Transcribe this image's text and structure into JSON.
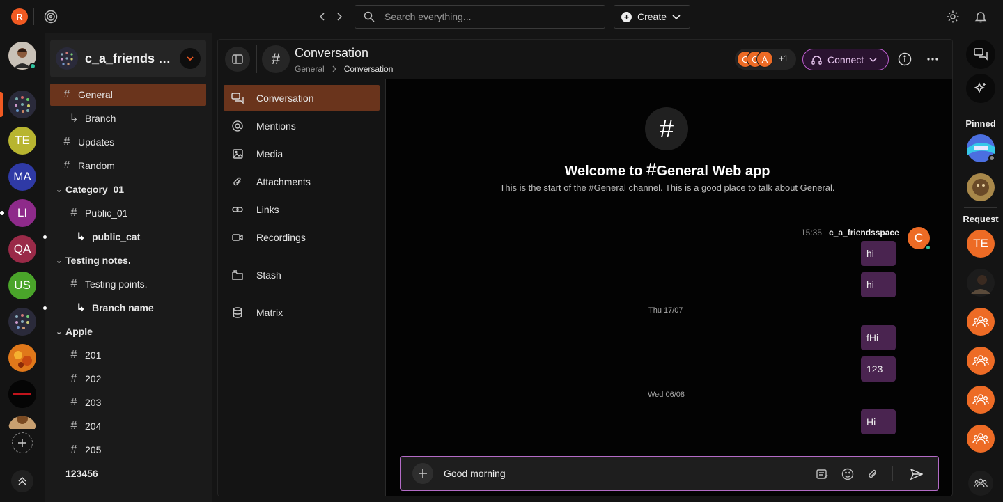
{
  "app": {
    "logo_letter": "R",
    "search_placeholder": "Search everything...",
    "create_label": "Create"
  },
  "rail": {
    "items": [
      {
        "label": "TE",
        "color": "#b8b530"
      },
      {
        "label": "MA",
        "color": "#2f3aa6"
      },
      {
        "label": "LI",
        "color": "#8e2a8a"
      },
      {
        "label": "QA",
        "color": "#9a2a48"
      },
      {
        "label": "US",
        "color": "#4aa42a"
      }
    ]
  },
  "sidebar": {
    "workspace_name": "c_a_friends sp...",
    "channels": [
      {
        "label": "General",
        "symbol": "#"
      },
      {
        "label": "Branch",
        "symbol": "↳"
      },
      {
        "label": "Updates",
        "symbol": "#"
      },
      {
        "label": "Random",
        "symbol": "#"
      }
    ],
    "categories": [
      {
        "name": "Category_01",
        "items": [
          {
            "label": "Public_01",
            "symbol": "#"
          },
          {
            "label": "public_cat",
            "symbol": "↳"
          }
        ]
      },
      {
        "name": "Testing notes.",
        "items": [
          {
            "label": "Testing points.",
            "symbol": "#"
          },
          {
            "label": "Branch name",
            "symbol": "↳"
          }
        ]
      },
      {
        "name": "Apple",
        "items": [
          {
            "label": "201",
            "symbol": "#"
          },
          {
            "label": "202",
            "symbol": "#"
          },
          {
            "label": "203",
            "symbol": "#"
          },
          {
            "label": "204",
            "symbol": "#"
          },
          {
            "label": "205",
            "symbol": "#"
          }
        ]
      }
    ],
    "footer_item": "123456"
  },
  "header": {
    "title": "Conversation",
    "breadcrumb": [
      "General",
      "Conversation"
    ],
    "member_initials": [
      "C",
      "C",
      "A"
    ],
    "member_extra": "+1",
    "connect_label": "Connect"
  },
  "subnav": {
    "items": [
      "Conversation",
      "Mentions",
      "Media",
      "Attachments",
      "Links",
      "Recordings",
      "Stash",
      "Matrix"
    ]
  },
  "chat": {
    "welcome_prefix": "Welcome to ",
    "welcome_hash": "#",
    "welcome_name": "General Web app",
    "welcome_sub": "This is the start of the #General channel. This is a good place to talk about General.",
    "message_time": "15:35",
    "message_author": "c_a_friendsspace",
    "author_initial": "C",
    "messages": [
      "hi",
      "hi",
      "fHi",
      "123",
      "Hi"
    ],
    "day_separators": [
      "Thu 17/07",
      "Wed 06/08"
    ],
    "composer_value": "Good morning"
  },
  "right_rail": {
    "pinned_label": "Pinned",
    "request_label": "Request",
    "request_initials": "TE"
  }
}
